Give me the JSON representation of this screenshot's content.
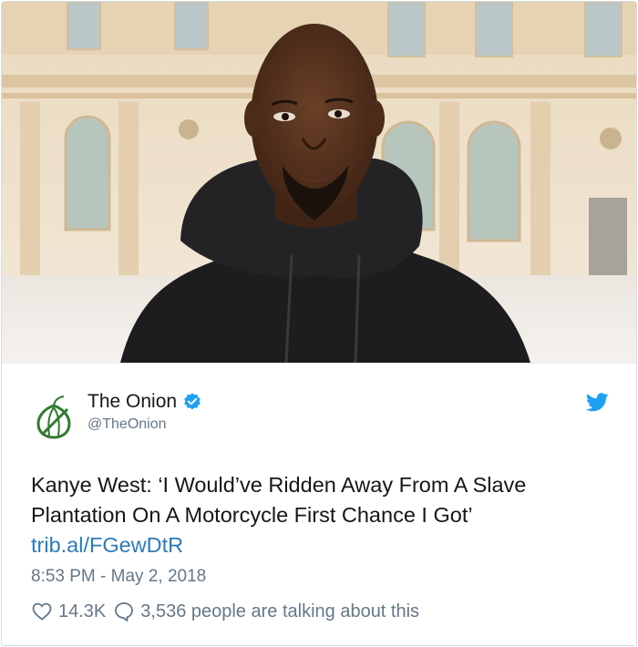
{
  "photo": {
    "subject": "portrait-photo"
  },
  "tweet": {
    "author": {
      "name": "The Onion",
      "handle": "@TheOnion",
      "verified": true
    },
    "text": "Kanye West: ‘I Would’ve Ridden Away From A Slave Plantation On A Motorcycle First Chance I Got’",
    "link": "trib.al/FGewDtR",
    "timestamp": "8:53 PM - May 2, 2018",
    "stats": {
      "likes": "14.3K",
      "talking": "3,536 people are talking about this"
    }
  },
  "colors": {
    "link": "#2b7bb9",
    "verified": "#1da1f2",
    "muted": "#657786",
    "onion_green": "#2f7a2f"
  },
  "icons": [
    "onion-logo-icon",
    "verified-badge-icon",
    "twitter-bird-icon",
    "heart-icon",
    "comment-icon"
  ]
}
